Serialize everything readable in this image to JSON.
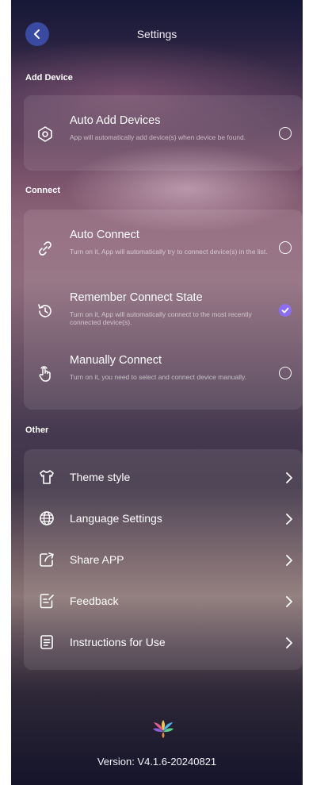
{
  "header": {
    "title": "Settings"
  },
  "sections": {
    "add_device": "Add Device",
    "connect": "Connect",
    "other": "Other"
  },
  "add_device": {
    "auto_add": {
      "title": "Auto Add Devices",
      "desc": "App will automatically add device(s) when device be found.",
      "checked": false
    }
  },
  "connect": {
    "auto_connect": {
      "title": "Auto Connect",
      "desc": "Turn on it, App will automatically try to connect device(s) in the list.",
      "checked": false
    },
    "remember_state": {
      "title": "Remember Connect State",
      "desc": "Turn on it, App will automatically connect to the most recently connected device(s).",
      "checked": true
    },
    "manual_connect": {
      "title": "Manually Connect",
      "desc": "Turn on it, you need to select and connect device manually.",
      "checked": false
    }
  },
  "other": {
    "items": [
      {
        "label": "Theme style",
        "icon": "shirt-icon"
      },
      {
        "label": "Language Settings",
        "icon": "globe-icon"
      },
      {
        "label": "Share APP",
        "icon": "share-icon"
      },
      {
        "label": "Feedback",
        "icon": "feedback-icon"
      },
      {
        "label": "Instructions for Use",
        "icon": "document-icon"
      }
    ]
  },
  "footer": {
    "version": "Version: V4.1.6-20240821"
  },
  "colors": {
    "accent": "#3a4aa0",
    "checked_radio": "#8a6ff0"
  }
}
